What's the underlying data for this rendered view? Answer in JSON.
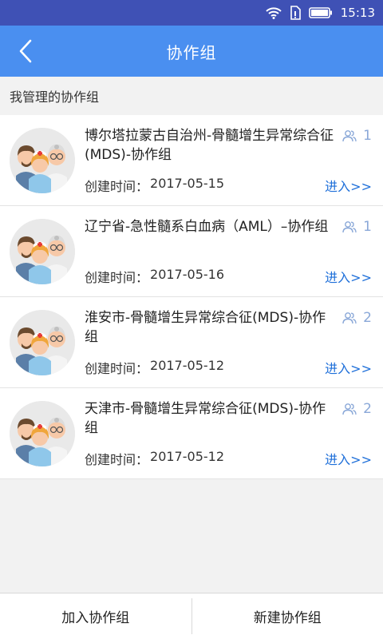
{
  "status_bar": {
    "time": "15:13",
    "icons": [
      "wifi-icon",
      "sim-icon",
      "battery-icon"
    ]
  },
  "header": {
    "title": "协作组",
    "back_icon": "chevron-left-icon"
  },
  "section": {
    "title": "我管理的协作组"
  },
  "groups": [
    {
      "name": "博尔塔拉蒙古自治州-骨髓增生异常综合征(MDS)-协作组",
      "members": "1",
      "created_label": "创建时间：",
      "created_date": "2017-05-15",
      "enter_label": "进入>>"
    },
    {
      "name": "辽宁省-急性髓系白血病（AML）–协作组",
      "members": "1",
      "created_label": "创建时间：",
      "created_date": "2017-05-16",
      "enter_label": "进入>>"
    },
    {
      "name": "淮安市-骨髓增生异常综合征(MDS)-协作组",
      "members": "2",
      "created_label": "创建时间：",
      "created_date": "2017-05-12",
      "enter_label": "进入>>"
    },
    {
      "name": "天津市-骨髓增生异常综合征(MDS)-协作组",
      "members": "2",
      "created_label": "创建时间：",
      "created_date": "2017-05-12",
      "enter_label": "进入>>"
    }
  ],
  "bottom": {
    "join_label": "加入协作组",
    "create_label": "新建协作组"
  },
  "colors": {
    "status_bar": "#3f51b5",
    "header": "#4a8ff0",
    "link": "#1e6fd9",
    "member_icon": "#8aa8d8"
  }
}
